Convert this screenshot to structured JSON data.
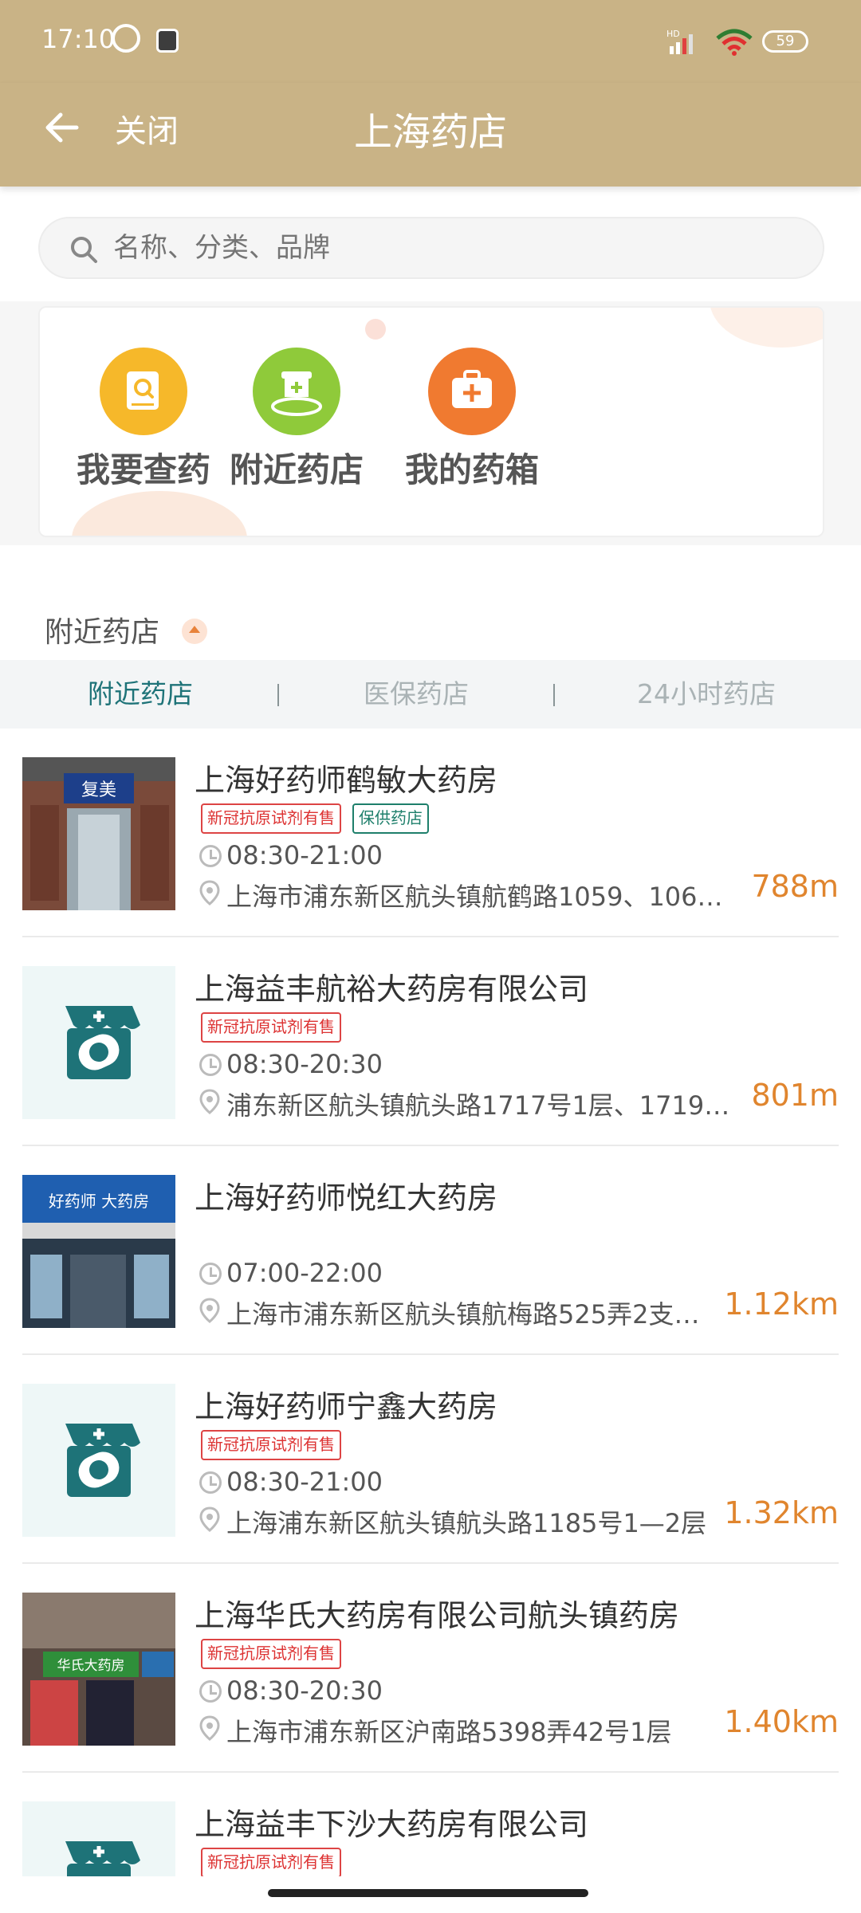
{
  "status_bar": {
    "time": "17:10",
    "battery": "59"
  },
  "nav": {
    "close_label": "关闭",
    "title": "上海药店"
  },
  "search": {
    "placeholder": "名称、分类、品牌"
  },
  "quick_actions": [
    {
      "label": "我要查药",
      "icon": "search-book-icon",
      "color": "#f6b82a"
    },
    {
      "label": "附近药店",
      "icon": "pharmacy-location-icon",
      "color": "#8fca3a"
    },
    {
      "label": "我的药箱",
      "icon": "medicine-box-icon",
      "color": "#f07a30"
    }
  ],
  "section": {
    "title": "附近药店"
  },
  "tabs": [
    {
      "label": "附近药店",
      "active": true
    },
    {
      "label": "医保药店",
      "active": false
    },
    {
      "label": "24小时药店",
      "active": false
    }
  ],
  "stores": [
    {
      "name": "上海好药师鹤敏大药房",
      "tags": [
        "新冠抗原试剂有售",
        "保供药店"
      ],
      "hours": "08:30-21:00",
      "address": "上海市浦东新区航头镇航鹤路1059、1061…",
      "distance": "788m",
      "thumb": "photo",
      "sign": "复美"
    },
    {
      "name": "上海益丰航裕大药房有限公司",
      "tags": [
        "新冠抗原试剂有售"
      ],
      "hours": "08:30-20:30",
      "address": "浦东新区航头镇航头路1717号1层、1719…",
      "distance": "801m",
      "thumb": "placeholder"
    },
    {
      "name": "上海好药师悦红大药房",
      "tags": [],
      "hours": "07:00-22:00",
      "address": "上海市浦东新区航头镇航梅路525弄2支…",
      "distance": "1.12km",
      "thumb": "photo",
      "sign": "好药师 大药房"
    },
    {
      "name": "上海好药师宁鑫大药房",
      "tags": [
        "新冠抗原试剂有售"
      ],
      "hours": "08:30-21:00",
      "address": "上海浦东新区航头镇航头路1185号1—2层",
      "distance": "1.32km",
      "thumb": "placeholder"
    },
    {
      "name": "上海华氏大药房有限公司航头镇药房",
      "tags": [
        "新冠抗原试剂有售"
      ],
      "hours": "08:30-20:30",
      "address": "上海市浦东新区沪南路5398弄42号1层",
      "distance": "1.40km",
      "thumb": "photo",
      "sign": "华氏大药房"
    },
    {
      "name": "上海益丰下沙大药房有限公司",
      "tags": [
        "新冠抗原试剂有售"
      ],
      "hours": "",
      "address": "",
      "distance": "",
      "thumb": "placeholder"
    }
  ],
  "colors": {
    "header": "#c9b386",
    "accent_teal": "#1e7378",
    "distance": "#e0852e",
    "tag_red": "#d33",
    "tag_green": "#1e7f6b"
  }
}
